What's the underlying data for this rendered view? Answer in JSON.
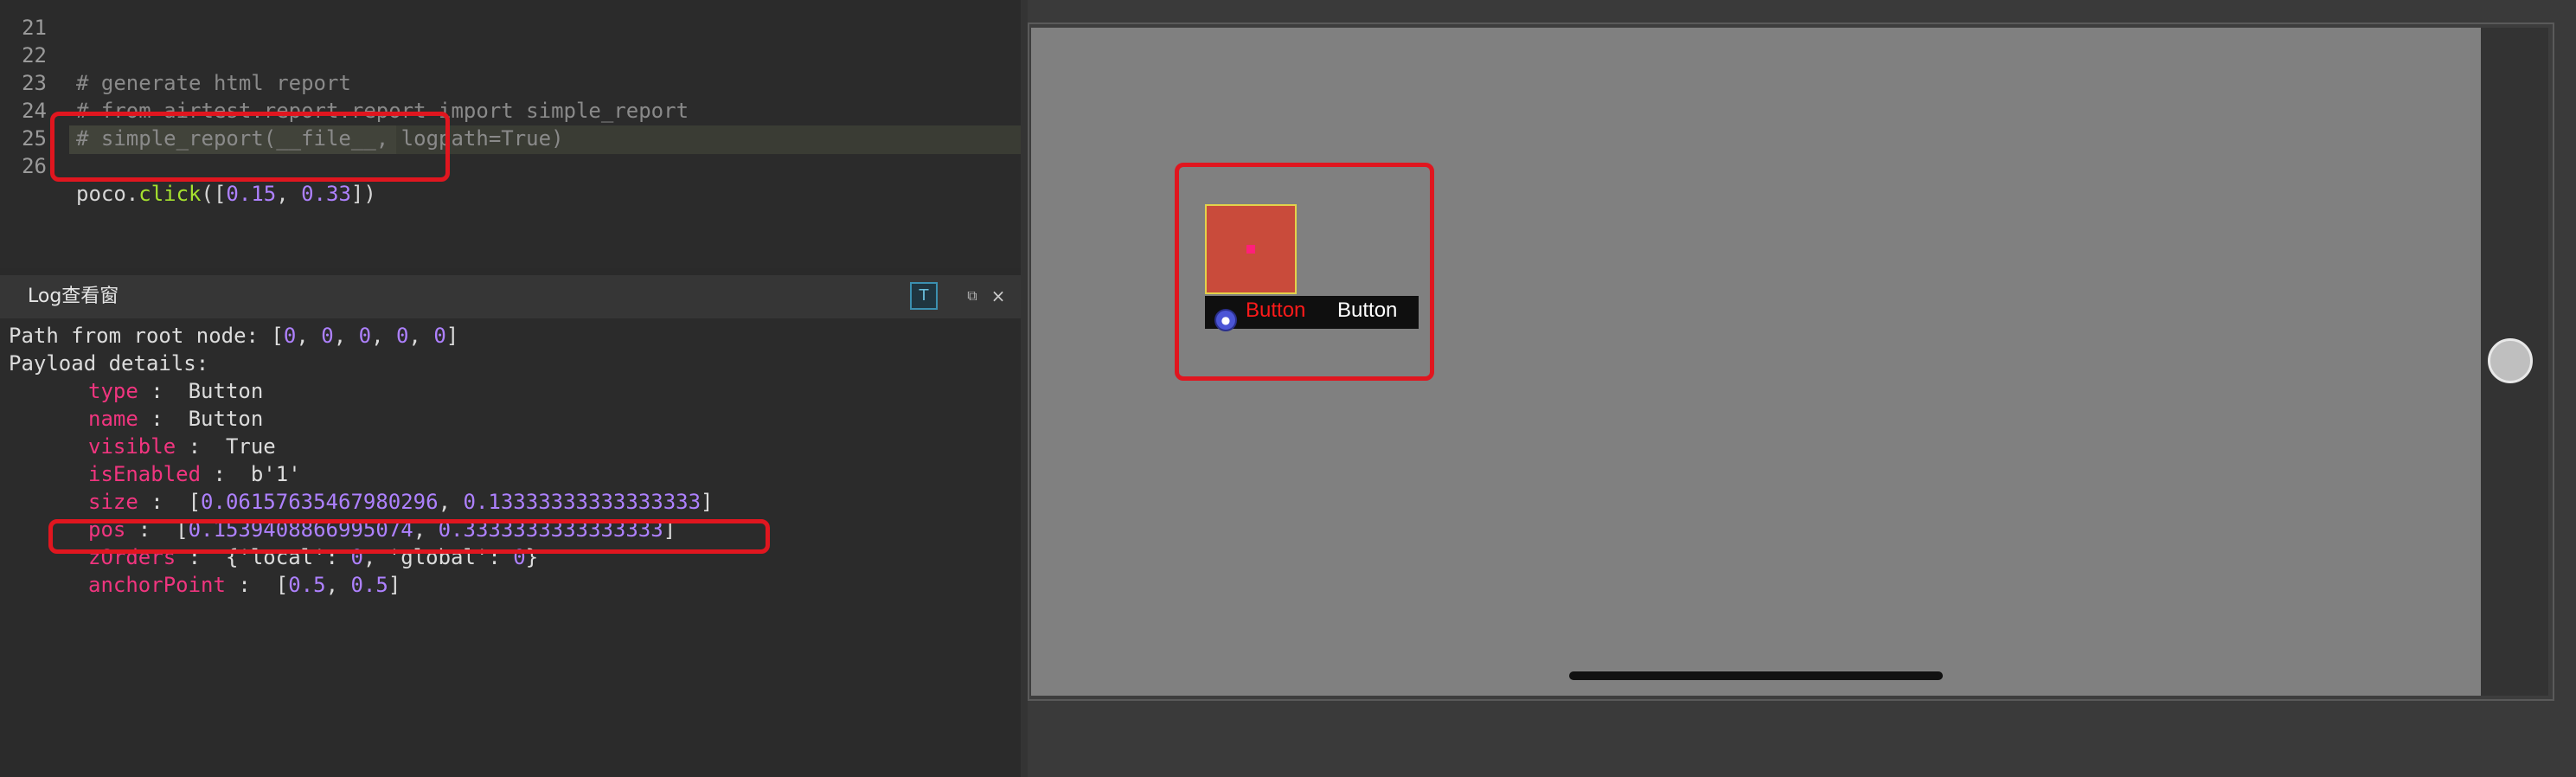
{
  "editor": {
    "lines": [
      {
        "number": "21",
        "text": ""
      },
      {
        "number": "22",
        "text": "# generate html report"
      },
      {
        "number": "23",
        "text": "# from airtest.report.report import simple_report"
      },
      {
        "number": "24",
        "text": "# simple_report(__file__, logpath=True)"
      },
      {
        "number": "25",
        "text": ""
      },
      {
        "number": "26",
        "text_parts": {
          "obj": "poco.",
          "fn": "click",
          "open": "([",
          "x": "0.15",
          "sep": ", ",
          "y": "0.33",
          "close": "])"
        }
      }
    ]
  },
  "log_panel": {
    "title": "Log查看窗",
    "filter_icon": "T",
    "float_icon": "⧉",
    "close_icon": "×",
    "path_prefix": "Path from root node: [",
    "path_values": [
      "0",
      "0",
      "0",
      "0",
      "0"
    ],
    "path_suffix": "]",
    "payload_header": "Payload details:",
    "fields": {
      "type": {
        "key": "type",
        "sep": " :  ",
        "value": "Button"
      },
      "name": {
        "key": "name",
        "sep": " :  ",
        "value": "Button"
      },
      "visible": {
        "key": "visible",
        "sep": " :  ",
        "value": "True"
      },
      "isEnabled": {
        "key": "isEnabled",
        "sep": " :  ",
        "value": "b'1'"
      },
      "size": {
        "key": "size",
        "sep": " :  ",
        "open": "[",
        "a": "0.06157635467980296",
        "comma": ", ",
        "b": "0.13333333333333333",
        "close": "]"
      },
      "pos": {
        "key": "pos",
        "sep": " :  ",
        "open": "[",
        "a": "0.1539408866995074",
        "comma": ", ",
        "b": "0.3333333333333333",
        "close": "]"
      },
      "zOrders": {
        "key": "zOrders",
        "sep": " :  ",
        "p1": "{'local': ",
        "local": "0",
        "p2": ", 'global': ",
        "global": "0",
        "p3": "}"
      },
      "anchorPoint": {
        "key": "anchorPoint",
        "sep": " :  ",
        "open": "[",
        "a": "0.5",
        "comma": ", ",
        "b": "0.5",
        "close": "]"
      }
    }
  },
  "device": {
    "label_red": "Button",
    "label_white": "Button",
    "poco_icon": "●"
  },
  "colors": {
    "highlight_box": "#e0161f",
    "key": "#f0357f",
    "number": "#ae81ff",
    "function": "#a6e22e",
    "comment": "#8a8a8a"
  }
}
